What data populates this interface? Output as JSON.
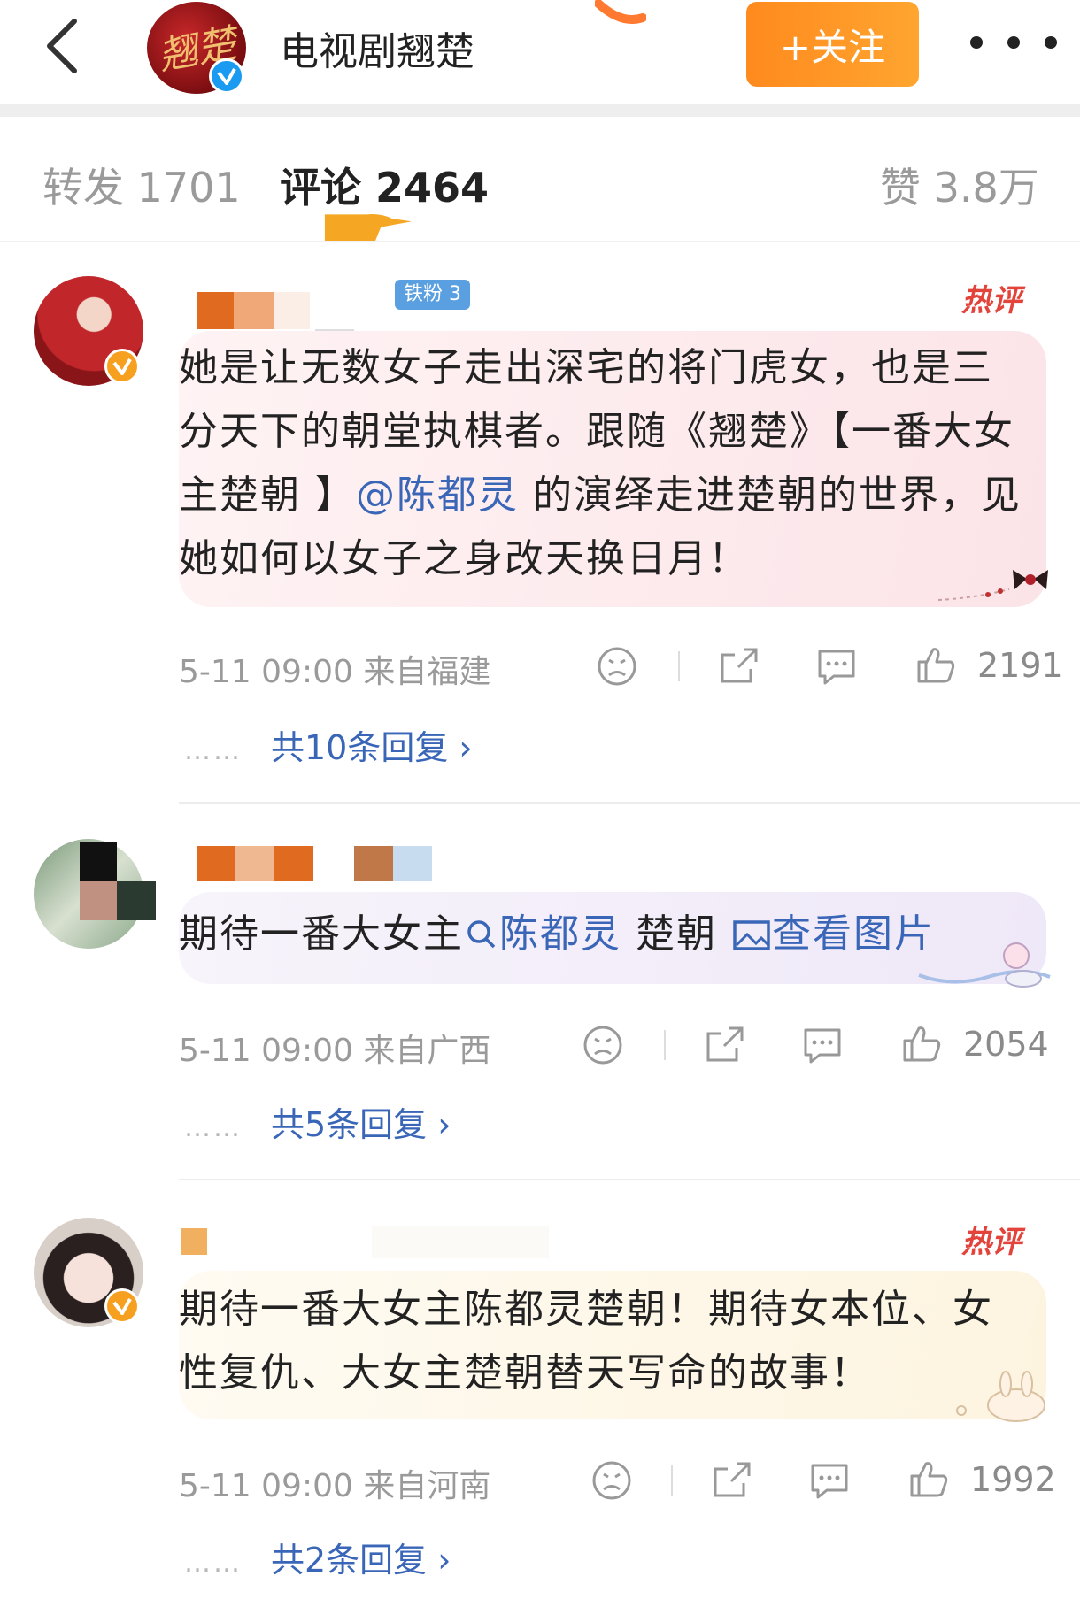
{
  "header": {
    "account_name": "电视剧翘楚",
    "avatar_calligraphy": "翘楚",
    "follow_label": "+关注"
  },
  "tabs": [
    {
      "label": "转发 1701",
      "active": false
    },
    {
      "label": "评论 2464",
      "active": true
    },
    {
      "label": "赞 3.8万",
      "active": false
    }
  ],
  "comments": [
    {
      "fan_badge": "铁粉 3",
      "hot_tag": "热评",
      "text_before": "她是让无数女子走出深宅的将门虎女，也是三分天下的朝堂执棋者。跟随《翘楚》【一番大女主楚朝 】",
      "mention": "@陈都灵",
      "text_after": " 的演绎走进楚朝的世界，见她如何以女子之身改天换日月！",
      "meta": "5-11 09:00  来自福建",
      "likes": "2191",
      "replies": "共10条回复 ›"
    },
    {
      "text_prefix": "期待一番大女主",
      "mention": "陈都灵",
      "text_mid": " 楚朝 ",
      "view_image": "查看图片",
      "meta": "5-11 09:00  来自广西",
      "likes": "2054",
      "replies": "共5条回复 ›"
    },
    {
      "hot_tag": "热评",
      "text": "期待一番大女主陈都灵楚朝！期待女本位、女性复仇、大女主楚朝替天写命的故事！",
      "meta": "5-11 09:00  来自河南",
      "likes": "1992",
      "replies": "共2条回复 ›"
    }
  ],
  "colors": {
    "accent_orange": "#ff9424",
    "link_blue": "#3a66b8",
    "hot_red": "#e2443c",
    "verify_blue": "#1a9af0",
    "verify_orange": "#f7a020"
  },
  "icons": [
    "back-arrow-icon",
    "more-icon",
    "verified-icon",
    "dislike-face-icon",
    "share-icon",
    "comment-icon",
    "thumbs-up-icon",
    "search-icon",
    "image-icon"
  ]
}
